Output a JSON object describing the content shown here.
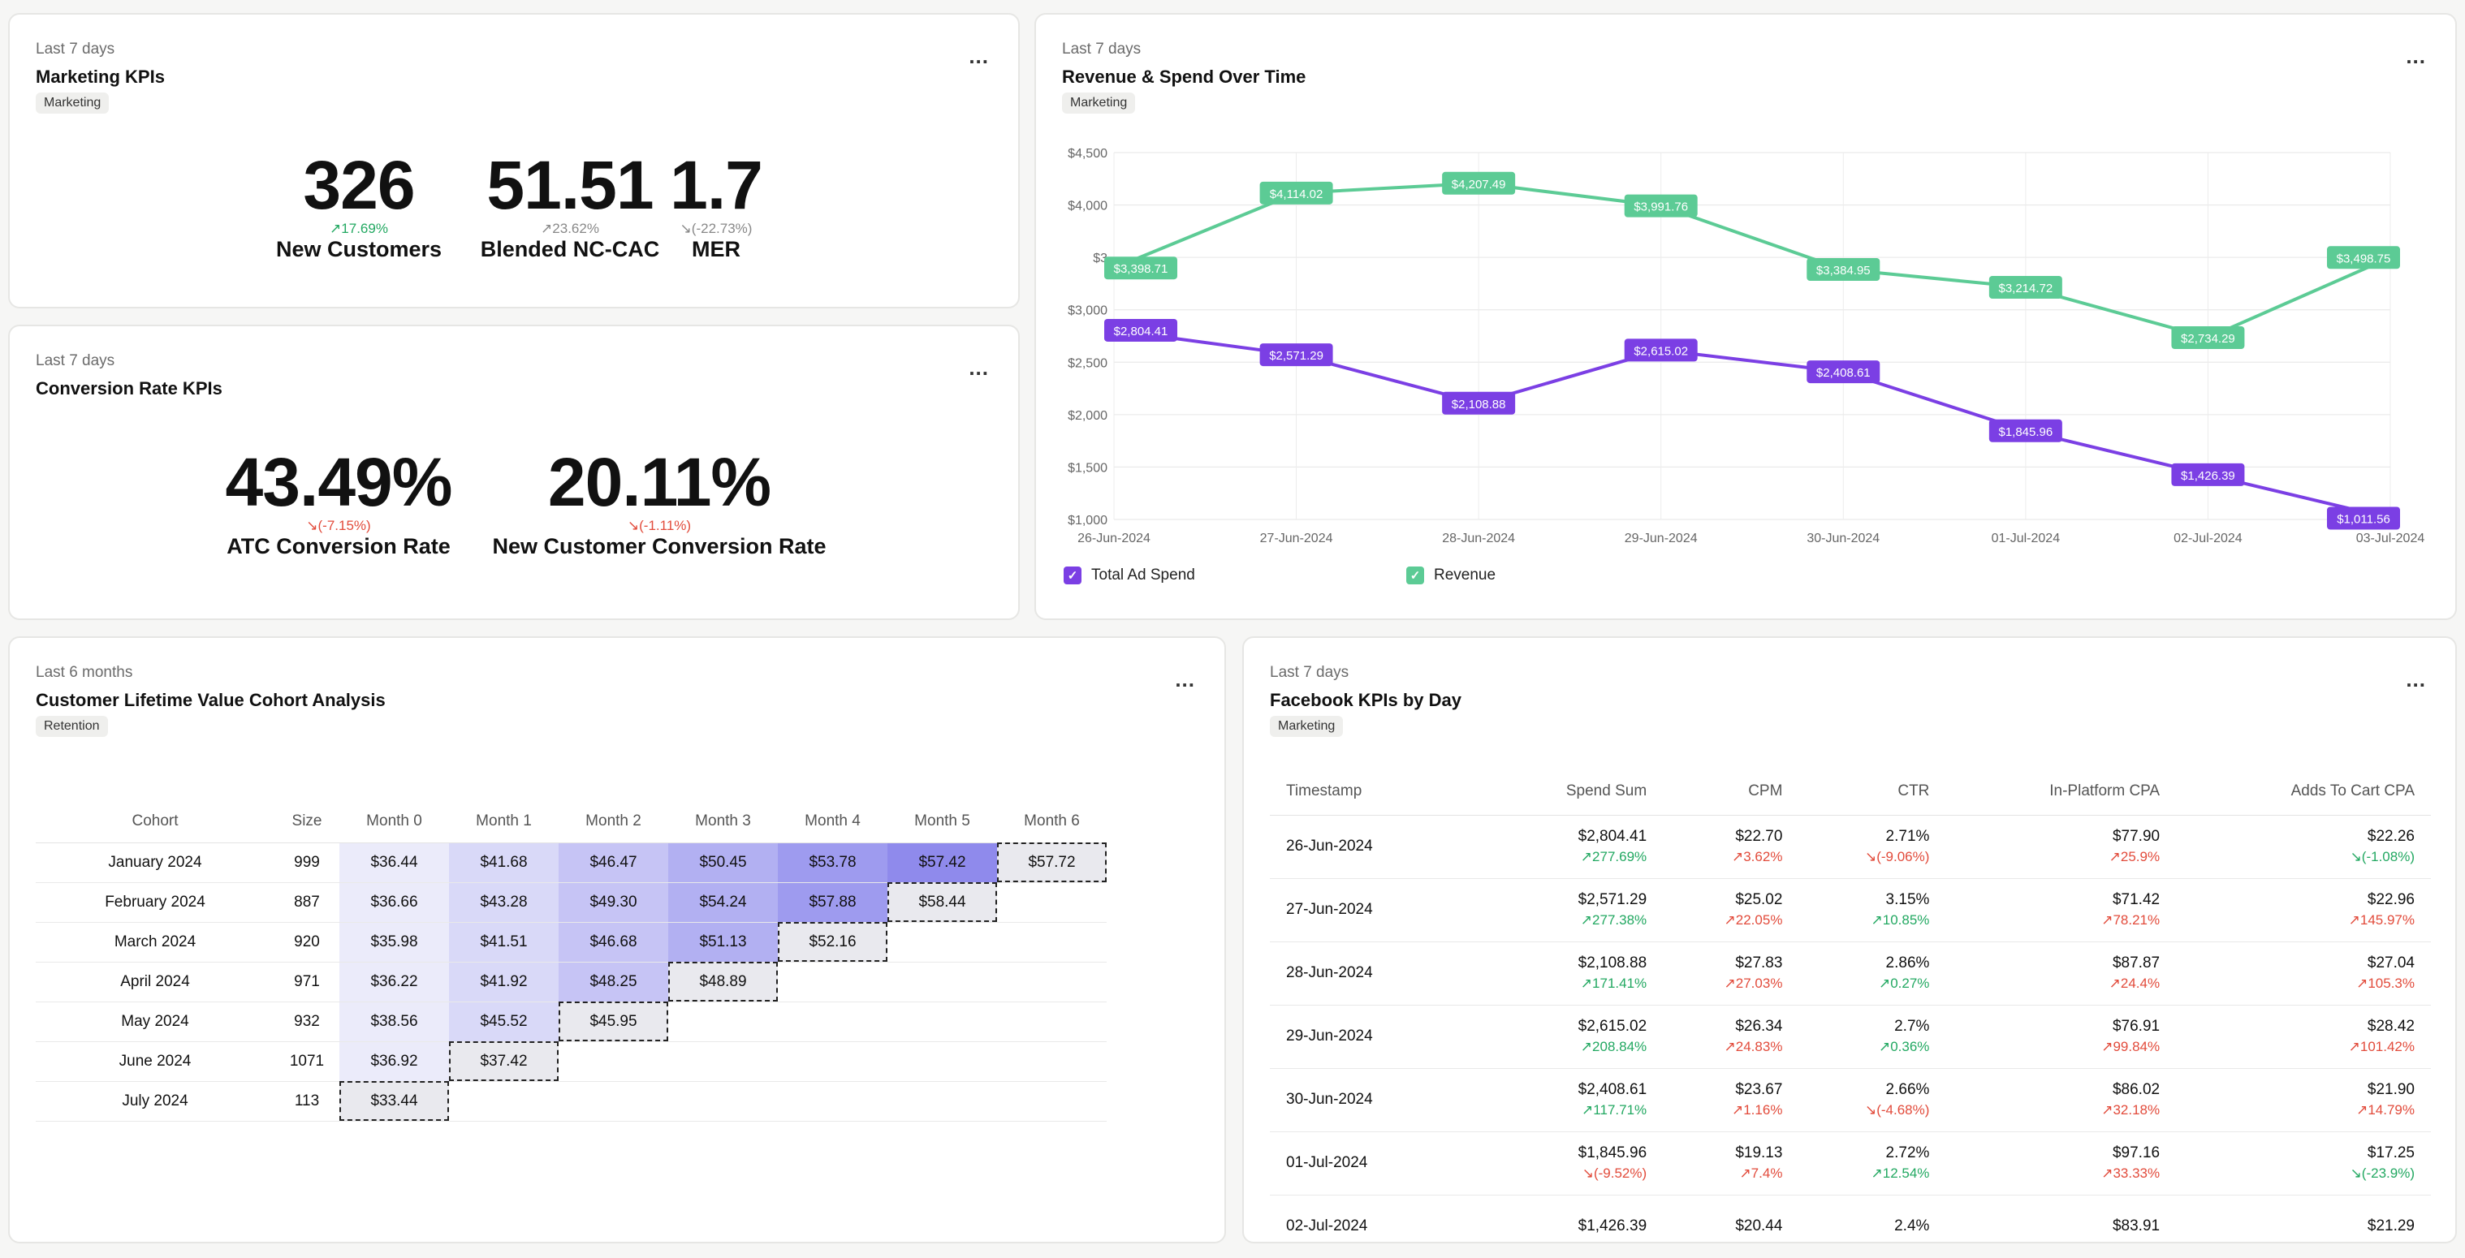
{
  "marketing_kpis": {
    "period": "Last 7 days",
    "title": "Marketing KPIs",
    "tag": "Marketing",
    "menu": "...",
    "kpis": [
      {
        "value": "326",
        "change": "↗17.69%",
        "dir": "up",
        "label": "New Customers"
      },
      {
        "value": "51.51",
        "change": "↗23.62%",
        "dir": "neutral",
        "label": "Blended NC-CAC"
      },
      {
        "value": "1.7",
        "change": "↘(-22.73%)",
        "dir": "neutral",
        "label": "MER"
      }
    ]
  },
  "conversion_kpis": {
    "period": "Last 7 days",
    "title": "Conversion Rate KPIs",
    "menu": "...",
    "kpis": [
      {
        "value": "43.49%",
        "change": "↘(-7.15%)",
        "dir": "down",
        "label": "ATC Conversion Rate"
      },
      {
        "value": "20.11%",
        "change": "↘(-1.11%)",
        "dir": "down",
        "label": "New Customer Conversion Rate"
      }
    ]
  },
  "revenue_chart": {
    "period": "Last 7 days",
    "title": "Revenue & Spend Over Time",
    "tag": "Marketing",
    "menu": "...",
    "legend": [
      {
        "label": "Total Ad Spend",
        "color": "#7b3fe4"
      },
      {
        "label": "Revenue",
        "color": "#5ccb95"
      }
    ]
  },
  "chart_data": {
    "type": "line",
    "x": [
      "26-Jun-2024",
      "27-Jun-2024",
      "28-Jun-2024",
      "29-Jun-2024",
      "30-Jun-2024",
      "01-Jul-2024",
      "02-Jul-2024",
      "03-Jul-2024"
    ],
    "series": [
      {
        "name": "Revenue",
        "color": "#5ccb95",
        "values": [
          3398.71,
          4114.02,
          4207.49,
          3991.76,
          3384.95,
          3214.72,
          2734.29,
          3498.75
        ],
        "labels": [
          "$3,398.71",
          "$4,114.02",
          "$4,207.49",
          "$3,991.76",
          "$3,384.95",
          "$3,214.72",
          "$2,734.29",
          "$3,498.75"
        ]
      },
      {
        "name": "Total Ad Spend",
        "color": "#7b3fe4",
        "values": [
          2804.41,
          2571.29,
          2108.88,
          2615.02,
          2408.61,
          1845.96,
          1426.39,
          1011.56
        ],
        "labels": [
          "$2,804.41",
          "$2,571.29",
          "$2,108.88",
          "$2,615.02",
          "$2,408.61",
          "$1,845.96",
          "$1,426.39",
          "$1,011.56"
        ]
      }
    ],
    "yticks": [
      "$1,000",
      "$1,500",
      "$2,000",
      "$2,500",
      "$3,000",
      "$3",
      "$4,000",
      "$4,500"
    ],
    "ytick_values": [
      1000,
      1500,
      2000,
      2500,
      3000,
      3500,
      4000,
      4500
    ],
    "ylim": [
      1000,
      4500
    ],
    "grid": true,
    "legend_position": "bottom-left"
  },
  "cohort": {
    "period": "Last 6 months",
    "title": "Customer Lifetime Value Cohort Analysis",
    "tag": "Retention",
    "menu": "...",
    "headers": [
      "Cohort",
      "Size",
      "Month 0",
      "Month 1",
      "Month 2",
      "Month 3",
      "Month 4",
      "Month 5",
      "Month 6"
    ],
    "rows": [
      {
        "cohort": "January 2024",
        "size": "999",
        "values": [
          "$36.44",
          "$41.68",
          "$46.47",
          "$50.45",
          "$53.78",
          "$57.42",
          "$57.72"
        ]
      },
      {
        "cohort": "February 2024",
        "size": "887",
        "values": [
          "$36.66",
          "$43.28",
          "$49.30",
          "$54.24",
          "$57.88",
          "$58.44"
        ]
      },
      {
        "cohort": "March 2024",
        "size": "920",
        "values": [
          "$35.98",
          "$41.51",
          "$46.68",
          "$51.13",
          "$52.16"
        ]
      },
      {
        "cohort": "April 2024",
        "size": "971",
        "values": [
          "$36.22",
          "$41.92",
          "$48.25",
          "$48.89"
        ]
      },
      {
        "cohort": "May 2024",
        "size": "932",
        "values": [
          "$38.56",
          "$45.52",
          "$45.95"
        ]
      },
      {
        "cohort": "June 2024",
        "size": "1071",
        "values": [
          "$36.92",
          "$37.42"
        ]
      },
      {
        "cohort": "July 2024",
        "size": "113",
        "values": [
          "$33.44"
        ]
      }
    ]
  },
  "facebook": {
    "period": "Last 7 days",
    "title": "Facebook KPIs by Day",
    "tag": "Marketing",
    "menu": "...",
    "headers": [
      "Timestamp",
      "Spend Sum",
      "CPM",
      "CTR",
      "In-Platform CPA",
      "Adds To Cart CPA"
    ],
    "rows": [
      {
        "ts": "26-Jun-2024",
        "cells": [
          [
            "$2,804.41",
            "↗277.69%",
            "up"
          ],
          [
            "$22.70",
            "↗3.62%",
            "down"
          ],
          [
            "2.71%",
            "↘(-9.06%)",
            "down"
          ],
          [
            "$77.90",
            "↗25.9%",
            "down"
          ],
          [
            "$22.26",
            "↘(-1.08%)",
            "up"
          ]
        ]
      },
      {
        "ts": "27-Jun-2024",
        "cells": [
          [
            "$2,571.29",
            "↗277.38%",
            "up"
          ],
          [
            "$25.02",
            "↗22.05%",
            "down"
          ],
          [
            "3.15%",
            "↗10.85%",
            "up"
          ],
          [
            "$71.42",
            "↗78.21%",
            "down"
          ],
          [
            "$22.96",
            "↗145.97%",
            "down"
          ]
        ]
      },
      {
        "ts": "28-Jun-2024",
        "cells": [
          [
            "$2,108.88",
            "↗171.41%",
            "up"
          ],
          [
            "$27.83",
            "↗27.03%",
            "down"
          ],
          [
            "2.86%",
            "↗0.27%",
            "up"
          ],
          [
            "$87.87",
            "↗24.4%",
            "down"
          ],
          [
            "$27.04",
            "↗105.3%",
            "down"
          ]
        ]
      },
      {
        "ts": "29-Jun-2024",
        "cells": [
          [
            "$2,615.02",
            "↗208.84%",
            "up"
          ],
          [
            "$26.34",
            "↗24.83%",
            "down"
          ],
          [
            "2.7%",
            "↗0.36%",
            "up"
          ],
          [
            "$76.91",
            "↗99.84%",
            "down"
          ],
          [
            "$28.42",
            "↗101.42%",
            "down"
          ]
        ]
      },
      {
        "ts": "30-Jun-2024",
        "cells": [
          [
            "$2,408.61",
            "↗117.71%",
            "up"
          ],
          [
            "$23.67",
            "↗1.16%",
            "down"
          ],
          [
            "2.66%",
            "↘(-4.68%)",
            "down"
          ],
          [
            "$86.02",
            "↗32.18%",
            "down"
          ],
          [
            "$21.90",
            "↗14.79%",
            "down"
          ]
        ]
      },
      {
        "ts": "01-Jul-2024",
        "cells": [
          [
            "$1,845.96",
            "↘(-9.52%)",
            "down"
          ],
          [
            "$19.13",
            "↗7.4%",
            "down"
          ],
          [
            "2.72%",
            "↗12.54%",
            "up"
          ],
          [
            "$97.16",
            "↗33.33%",
            "down"
          ],
          [
            "$17.25",
            "↘(-23.9%)",
            "up"
          ]
        ]
      },
      {
        "ts": "02-Jul-2024",
        "cells": [
          [
            "$1,426.39",
            "",
            ""
          ],
          [
            "$20.44",
            "",
            ""
          ],
          [
            "2.4%",
            "",
            ""
          ],
          [
            "$83.91",
            "",
            ""
          ],
          [
            "$21.29",
            "",
            ""
          ]
        ]
      }
    ]
  }
}
